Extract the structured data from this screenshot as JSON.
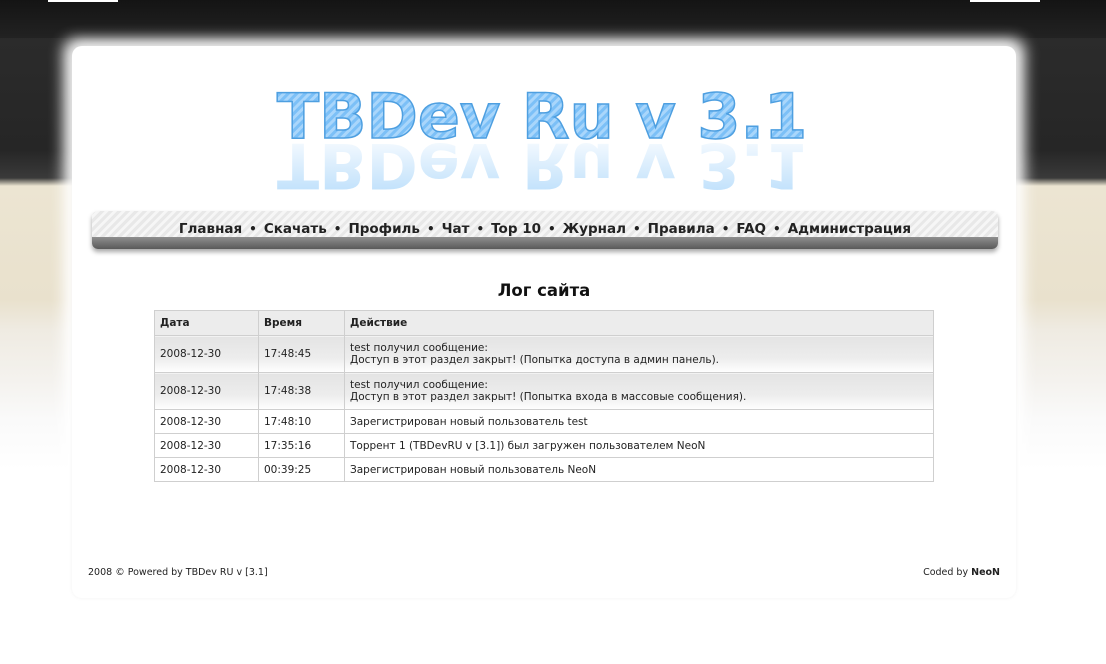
{
  "logo": {
    "text": "TBDev Ru v 3.1",
    "color": "#6cb8f5"
  },
  "nav": {
    "items": [
      "Главная",
      "Скачать",
      "Профиль",
      "Чат",
      "Top 10",
      "Журнал",
      "Правила",
      "FAQ",
      "Администрация"
    ],
    "separator": "•"
  },
  "page_title": "Лог сайта",
  "table": {
    "headers": [
      "Дата",
      "Время",
      "Действие"
    ],
    "rows": [
      {
        "date": "2008-12-30",
        "time": "17:48:45",
        "action_line1": "test получил сообщение:",
        "action_line2": "Доступ в этот раздел закрыт! (Попытка доступа в админ панель)."
      },
      {
        "date": "2008-12-30",
        "time": "17:48:38",
        "action_line1": "test получил сообщение:",
        "action_line2": "Доступ в этот раздел закрыт! (Попытка входа в массовые сообщения)."
      },
      {
        "date": "2008-12-30",
        "time": "17:48:10",
        "action": "Зарегистрирован новый пользователь test"
      },
      {
        "date": "2008-12-30",
        "time": "17:35:16",
        "action": "Торрент 1 (TBDevRU v [3.1]) был загружен пользователем NeoN"
      },
      {
        "date": "2008-12-30",
        "time": "00:39:25",
        "action": "Зарегистрирован новый пользователь NeoN"
      }
    ]
  },
  "footer": {
    "left": "2008 © Powered by TBDev RU v [3.1]",
    "right_prefix": "Coded by",
    "right_author": "NeoN"
  }
}
